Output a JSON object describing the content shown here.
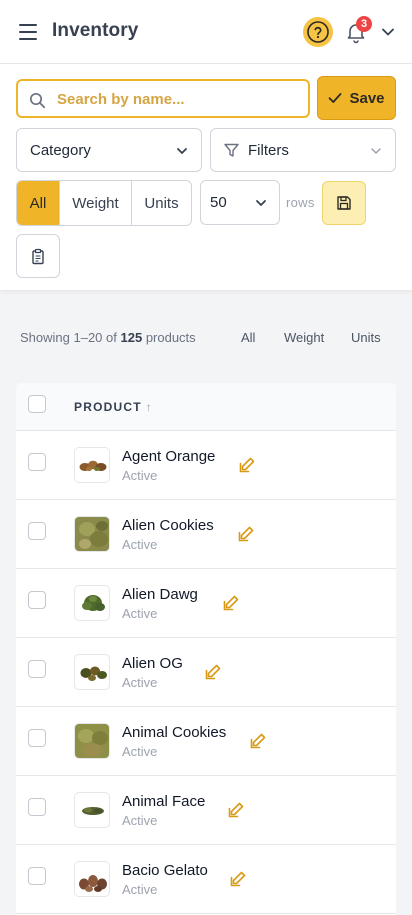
{
  "header": {
    "title": "Inventory",
    "menu_icon": "hamburger-menu-icon",
    "help_icon": "question-circle-icon",
    "notifications_icon": "bell-icon",
    "notification_count": "3",
    "account_icon": "chevron-down-icon"
  },
  "search": {
    "placeholder": "Search by name...",
    "value": "",
    "icon": "search-icon"
  },
  "save_button": {
    "label": "Save",
    "icon": "check-icon"
  },
  "category_select": {
    "label": "Category"
  },
  "filters_select": {
    "label": "Filters",
    "icon": "funnel-icon"
  },
  "type_toggle": {
    "options": [
      "All",
      "Weight",
      "Units"
    ],
    "selected": "All"
  },
  "rows_select": {
    "value": "50",
    "suffix": "rows"
  },
  "actions": {
    "save_view_icon": "floppy-disk-icon",
    "clipboard_icon": "clipboard-icon"
  },
  "summary": {
    "prefix": "Showing 1–20 of",
    "total": "125",
    "suffix": "products",
    "tabs": [
      "All",
      "Weight",
      "Units"
    ]
  },
  "table": {
    "column_header": "PRODUCT",
    "sort_arrow": "↑",
    "rows": [
      {
        "name": "Agent Orange",
        "status": "Active"
      },
      {
        "name": "Alien Cookies",
        "status": "Active"
      },
      {
        "name": "Alien Dawg",
        "status": "Active"
      },
      {
        "name": "Alien OG",
        "status": "Active"
      },
      {
        "name": "Animal Cookies",
        "status": "Active"
      },
      {
        "name": "Animal Face",
        "status": "Active"
      },
      {
        "name": "Bacio Gelato",
        "status": "Active"
      }
    ]
  },
  "colors": {
    "accent": "#f0b429",
    "accent_light": "#fdefb3",
    "badge": "#ef4444",
    "text_dark": "#374151",
    "muted": "#9ca3af"
  }
}
